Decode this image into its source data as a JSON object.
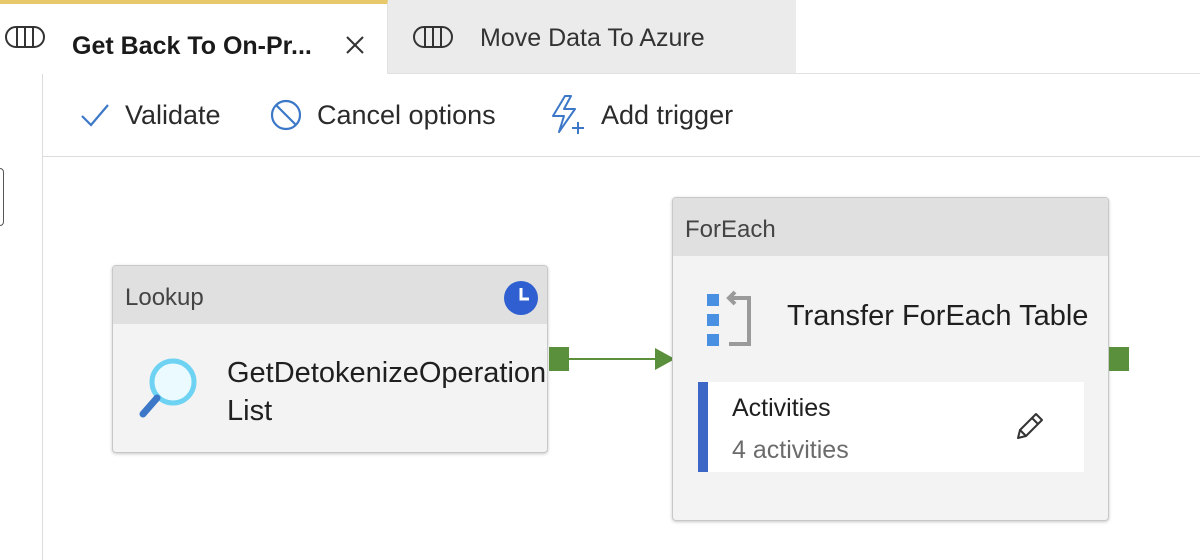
{
  "tabs": [
    {
      "title": "Get Back To On-Pr...",
      "active": true,
      "icon": "pipeline-icon",
      "close_icon": "close-icon"
    },
    {
      "title": "Move Data To Azure",
      "active": false,
      "icon": "pipeline-icon"
    }
  ],
  "toolbar": {
    "validate_label": "Validate",
    "cancel_label": "Cancel options",
    "trigger_label": "Add trigger"
  },
  "canvas": {
    "lookup": {
      "type": "Lookup",
      "name": "GetDetokenizeOperationList",
      "icon": "lookup-magnifier-icon",
      "status_icon": "clock-icon"
    },
    "foreach": {
      "type": "ForEach",
      "name": "Transfer ForEach Table",
      "icon": "foreach-icon",
      "activities_label": "Activities",
      "activities_count": "4 activities",
      "edit_icon": "pencil-icon"
    }
  },
  "colors": {
    "accent_tab": "#e8c96a",
    "port_green": "#5a8f3c",
    "inner_bar_blue": "#3c67c7",
    "icon_blue": "#3d78c8",
    "clock_blue": "#2f5fd0"
  }
}
